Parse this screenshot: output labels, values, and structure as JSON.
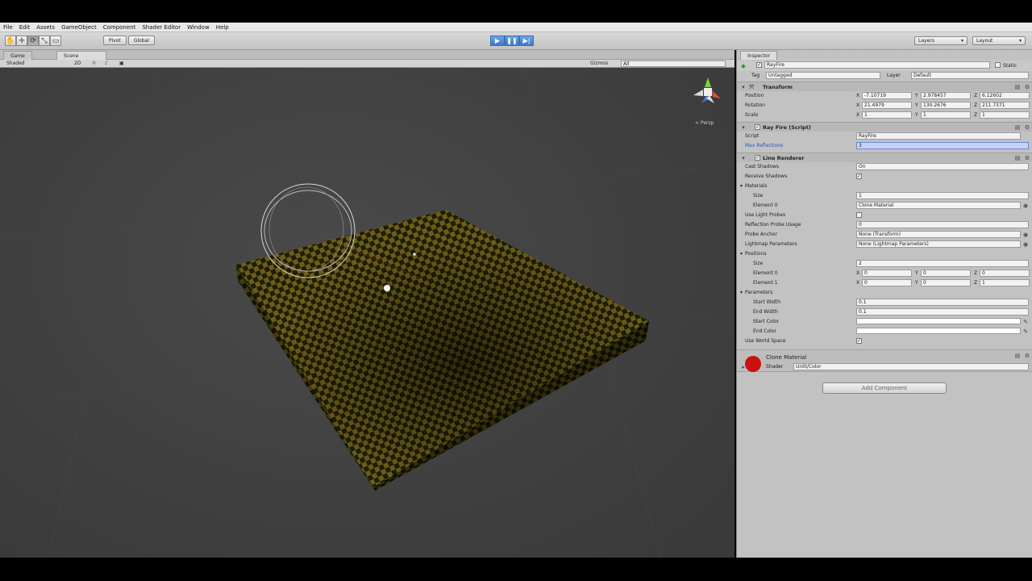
{
  "menu": [
    "File",
    "Edit",
    "Assets",
    "GameObject",
    "Component",
    "Shader Editor",
    "Window",
    "Help"
  ],
  "toolbar": {
    "pivot_label": "Pivot",
    "global_label": "Global",
    "layers_label": "Layers",
    "layout_label": "Layout"
  },
  "scene": {
    "tab_game": "Game",
    "tab_scene": "Scene",
    "shading_mode": "Shaded",
    "mode_2d": "2D",
    "gizmos_label": "Gizmos",
    "search_placeholder": "All",
    "persp_label": "< Persp"
  },
  "inspector": {
    "tab_label": "Inspector",
    "object_name": "RayFire",
    "static_label": "Static",
    "tag_label": "Tag",
    "tag_value": "Untagged",
    "layer_label": "Layer",
    "layer_value": "Default",
    "transform": {
      "title": "Transform",
      "position_label": "Position",
      "rotation_label": "Rotation",
      "scale_label": "Scale",
      "position": [
        "-7.10719",
        "2.978457",
        "6.12602"
      ],
      "rotation": [
        "21.4979",
        "130.2676",
        "211.7371"
      ],
      "scale": [
        "1",
        "1",
        "1"
      ]
    },
    "script_comp": {
      "title": "Ray Fire (Script)",
      "script_label": "Script",
      "script_value": "RayFire",
      "max_label": "Max Reflections",
      "max_value": "3"
    },
    "line_renderer": {
      "title": "Line Renderer",
      "cast_shadows_label": "Cast Shadows",
      "cast_shadows_value": "On",
      "receive_shadows_label": "Receive Shadows",
      "materials_label": "Materials",
      "size_label": "Size",
      "size_value": "1",
      "element0_label": "Element 0",
      "element0_value": "Clone Material",
      "light_probes_label": "Use Light Probes",
      "refl_probe_label": "Reflection Probe Usage",
      "refl_probe_value": "0",
      "probe_anchor_label": "Probe Anchor",
      "probe_anchor_value": "None (Transform)",
      "lightmap_label": "Lightmap Parameters",
      "lightmap_value": "None (Lightmap Parameters)",
      "positions_label": "Positions",
      "pos_size_label": "Size",
      "pos_size_value": "2",
      "pos_el0_label": "Element 0",
      "pos_el1_label": "Element 1",
      "pos_el0": [
        "0",
        "0",
        "0"
      ],
      "pos_el1": [
        "0",
        "0",
        "1"
      ],
      "parameters_label": "Parameters",
      "start_width_label": "Start Width",
      "start_width_value": "0.1",
      "end_width_label": "End Width",
      "end_width_value": "0.1",
      "start_color_label": "Start Color",
      "end_color_label": "End Color",
      "world_space_label": "Use World Space"
    },
    "material": {
      "name": "Clone Material",
      "shader_label": "Shader",
      "shader_value": "Unlit/Color",
      "swatch_color": "#cc1111"
    },
    "add_component_label": "Add Component"
  },
  "colors": {
    "accent_play": "#3b78c8",
    "floor_dark": "#1f1c06",
    "floor_light": "#6b5e16"
  }
}
